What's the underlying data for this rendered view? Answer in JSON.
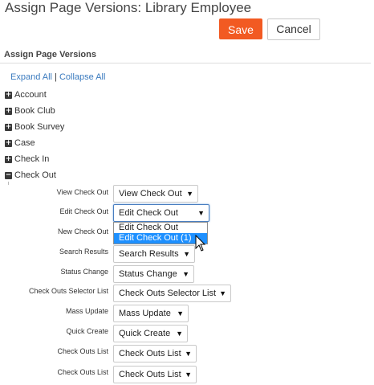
{
  "header": {
    "title": "Assign Page Versions: Library Employee"
  },
  "toolbar": {
    "save_label": "Save",
    "cancel_label": "Cancel"
  },
  "section": {
    "title": "Assign Page Versions"
  },
  "links": {
    "expand_all": "Expand All",
    "separator": "|",
    "collapse_all": "Collapse All"
  },
  "tree": [
    {
      "label": "Account",
      "state": "+"
    },
    {
      "label": "Book Club",
      "state": "+"
    },
    {
      "label": "Book Survey",
      "state": "+"
    },
    {
      "label": "Case",
      "state": "+"
    },
    {
      "label": "Check In",
      "state": "+"
    },
    {
      "label": "Check Out",
      "state": "−"
    }
  ],
  "checkout_rows": [
    {
      "label": "View Check Out",
      "value": "View Check Out"
    },
    {
      "label": "Edit Check Out",
      "value": "Edit Check Out"
    },
    {
      "label": "New Check Out",
      "value": ""
    },
    {
      "label": "Search Results",
      "value": "Search Results"
    },
    {
      "label": "Status Change",
      "value": "Status Change"
    },
    {
      "label": "Check Outs Selector List",
      "value": "Check Outs Selector List"
    },
    {
      "label": "Mass Update",
      "value": "Mass Update"
    },
    {
      "label": "Quick Create",
      "value": "Quick Create"
    },
    {
      "label": "Check Outs List",
      "value": "Check Outs List"
    },
    {
      "label": "Check Outs List",
      "value": "Check Outs List"
    }
  ],
  "dropdown": {
    "options": [
      "Edit Check Out",
      "Edit Check Out (1)"
    ],
    "highlighted_index": 1
  },
  "arrow_glyph": "▼",
  "icons": {
    "expand": "plus-box-icon",
    "collapse": "minus-box-icon",
    "dropdown": "caret-down-icon",
    "cursor": "mouse-pointer-icon"
  },
  "colors": {
    "save_button": "#f25a22",
    "link": "#3b7bbf",
    "highlight": "#1e90ff",
    "focus_border": "#4a7fc1"
  }
}
